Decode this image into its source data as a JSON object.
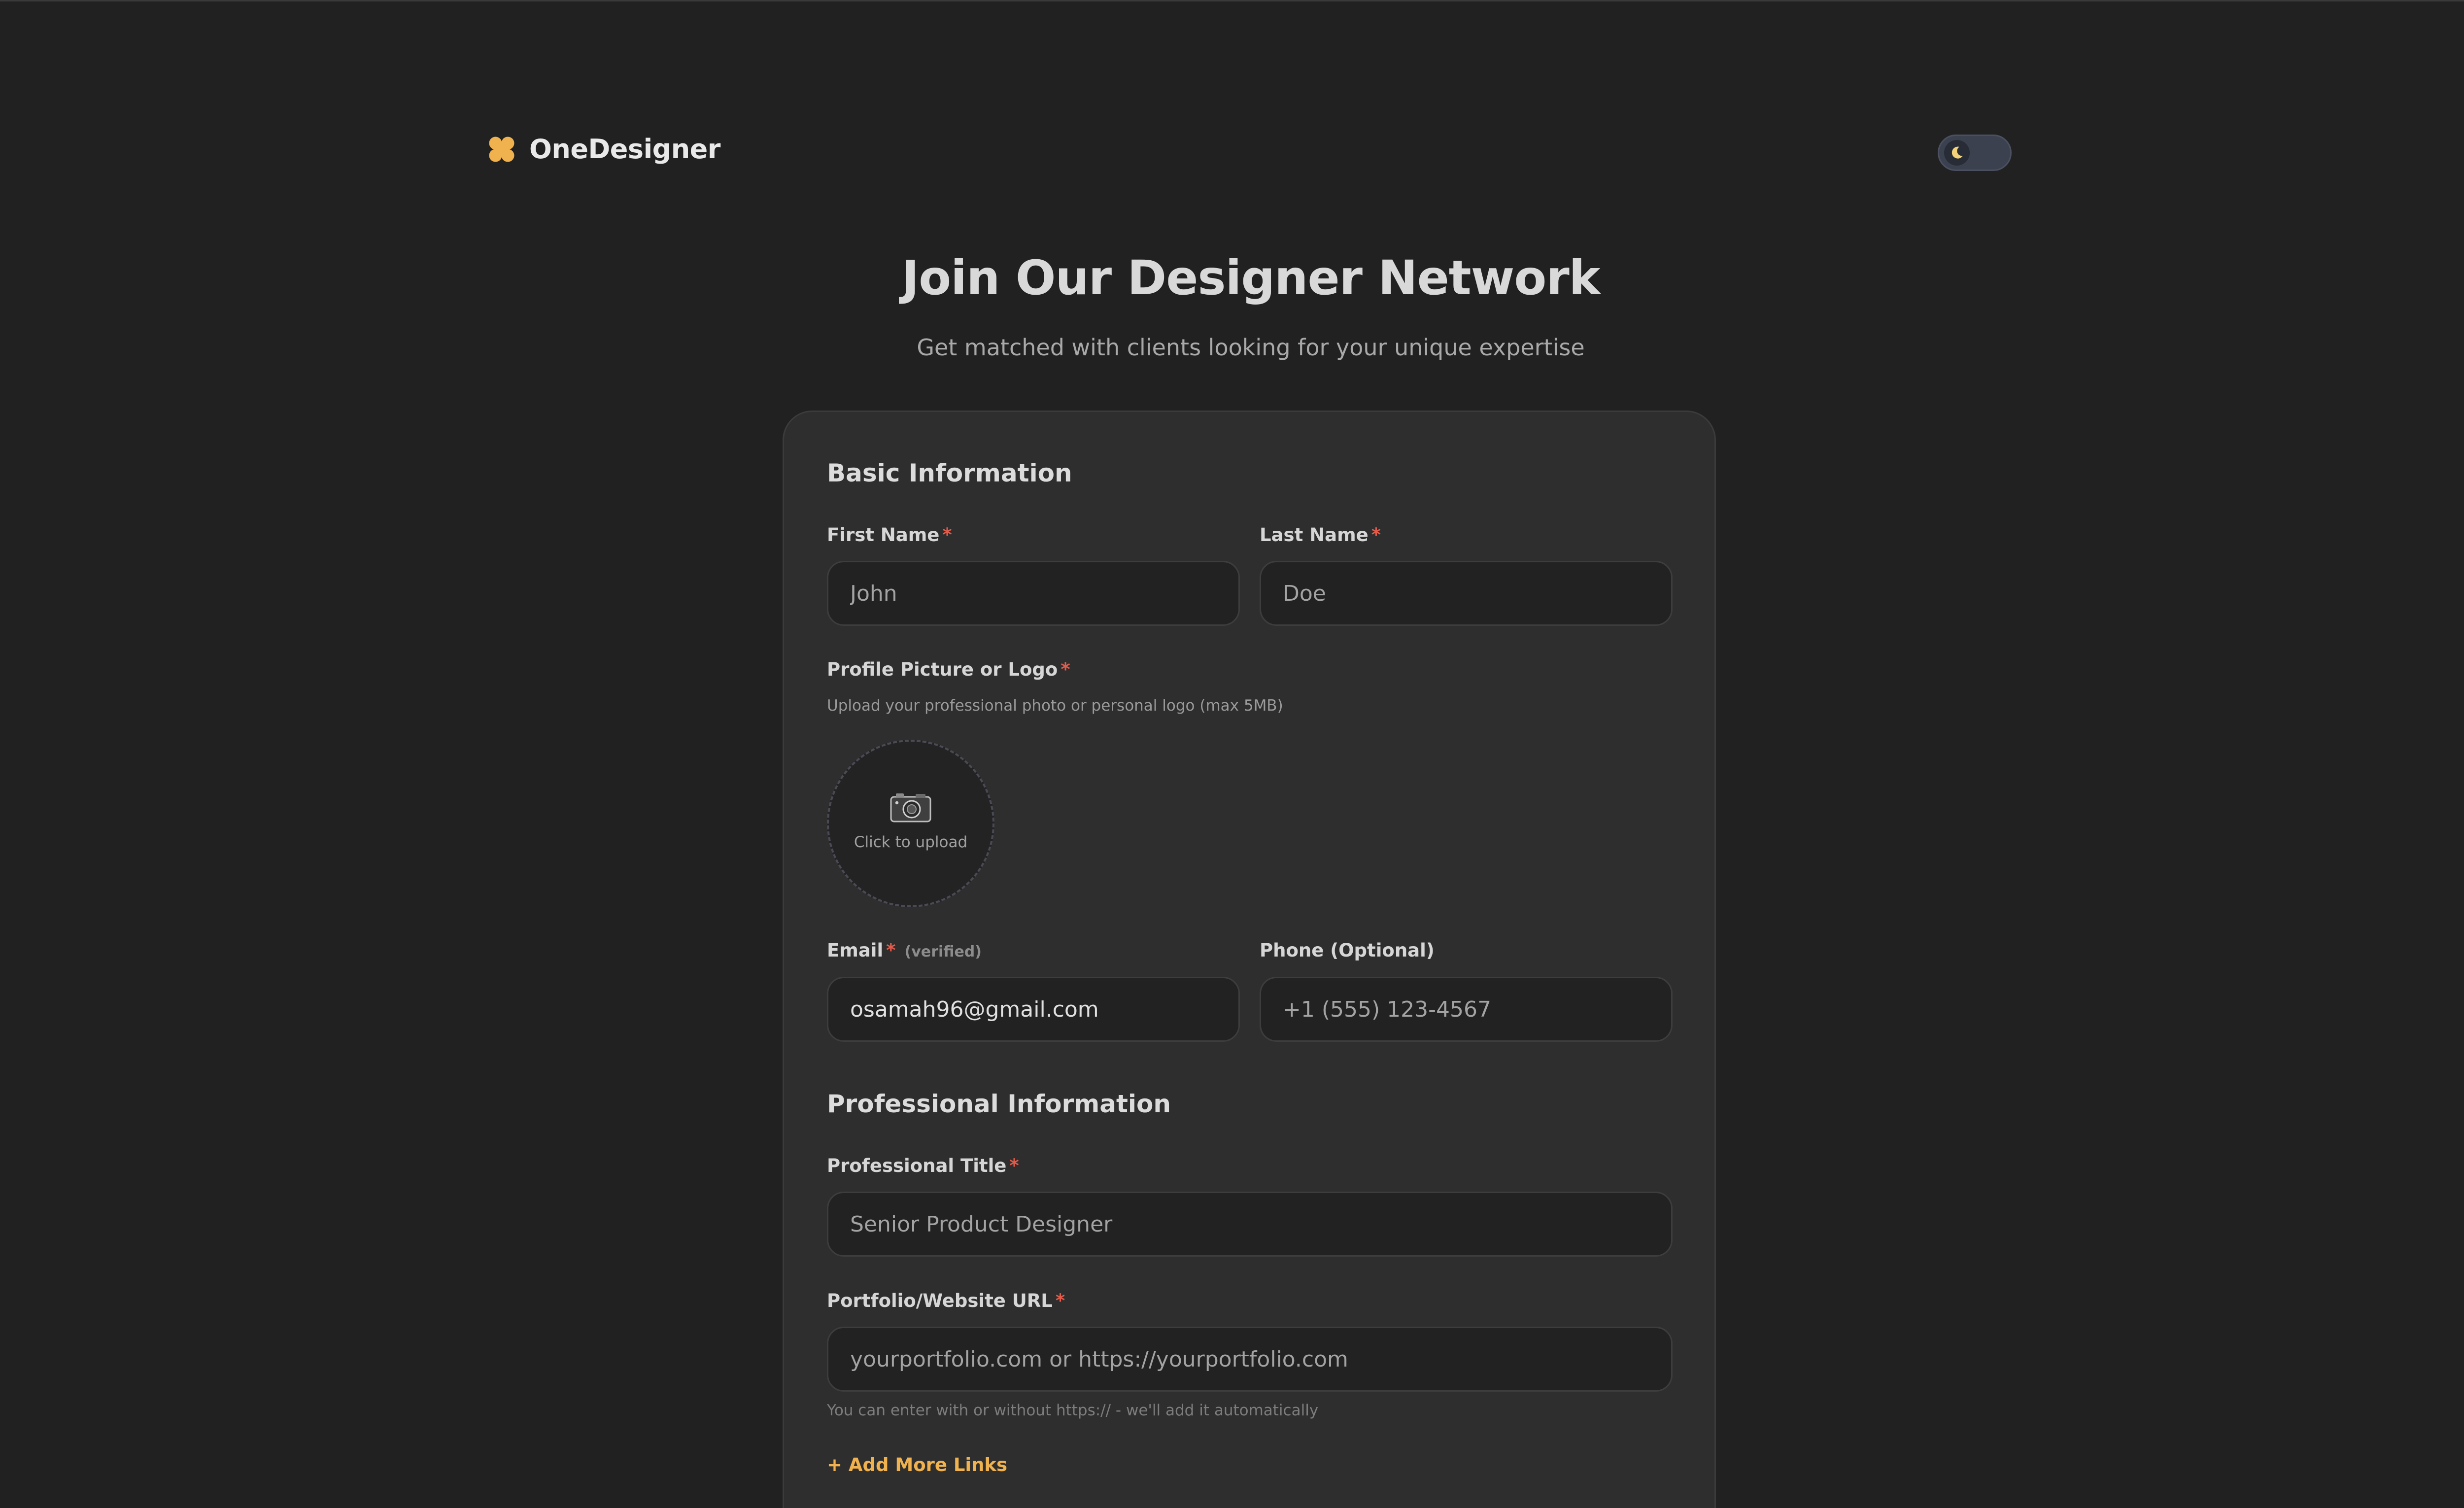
{
  "header": {
    "brand": "OneDesigner",
    "brand_color": "#f0b24f",
    "theme_toggle_icon": "moon-icon"
  },
  "hero": {
    "title": "Join Our Designer Network",
    "subtitle": "Get matched with clients looking for your unique expertise"
  },
  "form": {
    "basic_section_title": "Basic Information",
    "first_name": {
      "label": "First Name",
      "required": "*",
      "placeholder": "John",
      "value": ""
    },
    "last_name": {
      "label": "Last Name",
      "required": "*",
      "placeholder": "Doe",
      "value": ""
    },
    "profile_picture": {
      "label": "Profile Picture or Logo",
      "required": "*",
      "helper": "Upload your professional photo or personal logo (max 5MB)",
      "upload_icon": "camera-icon",
      "upload_text": "Click to upload"
    },
    "email": {
      "label": "Email",
      "required": "*",
      "note": "(verified)",
      "value": "osamah96@gmail.com"
    },
    "phone": {
      "label": "Phone (Optional)",
      "placeholder": "+1 (555) 123-4567",
      "value": ""
    },
    "professional_section_title": "Professional Information",
    "professional_title": {
      "label": "Professional Title",
      "required": "*",
      "placeholder": "Senior Product Designer",
      "value": ""
    },
    "portfolio_url": {
      "label": "Portfolio/Website URL",
      "required": "*",
      "placeholder": "yourportfolio.com or https://yourportfolio.com",
      "value": "",
      "helper": "You can enter with or without https:// - we'll add it automatically"
    },
    "add_more_links": "+ Add More Links"
  },
  "colors": {
    "background": "#212121",
    "card": "#2e2e2e",
    "input": "#222222",
    "required": "#e25b4b",
    "accent": "#f0b24f"
  }
}
